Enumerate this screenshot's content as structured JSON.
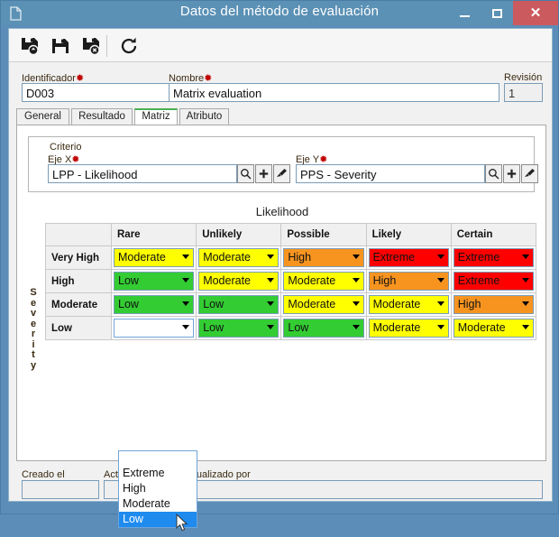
{
  "window": {
    "title": "Datos del método de evaluación",
    "icon": "document-icon",
    "controls": {
      "minimize": "–",
      "maximize": "□",
      "close": "✕"
    },
    "frame_color": "#5b8db8",
    "close_color": "#cb5a5e"
  },
  "toolbar": {
    "buttons": [
      {
        "name": "save-new-icon",
        "title": ""
      },
      {
        "name": "save-icon",
        "title": ""
      },
      {
        "name": "save-delete-icon",
        "title": ""
      },
      {
        "name": "refresh-icon",
        "title": ""
      }
    ]
  },
  "header_fields": {
    "identificador": {
      "label": "Identificador",
      "required": "✹",
      "value": "D003"
    },
    "nombre": {
      "label": "Nombre",
      "required": "✹",
      "value": "Matrix evaluation"
    },
    "revision": {
      "label": "Revisión",
      "value": "1"
    }
  },
  "tabs": [
    {
      "label": "General",
      "active": false
    },
    {
      "label": "Resultado",
      "active": false
    },
    {
      "label": "Matriz",
      "active": true
    },
    {
      "label": "Atributo",
      "active": false
    }
  ],
  "criterio": {
    "title": "Criterio",
    "eje_x": {
      "label": "Eje X",
      "required": "✹",
      "value": "LPP - Likelihood"
    },
    "eje_y": {
      "label": "Eje Y",
      "required": "✹",
      "value": "PPS - Severity"
    },
    "buttons": [
      "search-icon",
      "add-icon",
      "clear-brush-icon"
    ]
  },
  "matrix": {
    "x_axis_title": "Likelihood",
    "y_axis_title": "Severity",
    "columns": [
      "Rare",
      "Unlikely",
      "Possible",
      "Likely",
      "Certain"
    ],
    "rows": [
      {
        "header": "Very High",
        "cells": [
          {
            "value": "Moderate",
            "color": "#ffff00"
          },
          {
            "value": "Moderate",
            "color": "#ffff00"
          },
          {
            "value": "High",
            "color": "#f79420"
          },
          {
            "value": "Extreme",
            "color": "#ff0000"
          },
          {
            "value": "Extreme",
            "color": "#ff0000"
          }
        ]
      },
      {
        "header": "High",
        "cells": [
          {
            "value": "Low",
            "color": "#33cc33"
          },
          {
            "value": "Moderate",
            "color": "#ffff00"
          },
          {
            "value": "Moderate",
            "color": "#ffff00"
          },
          {
            "value": "High",
            "color": "#f79420"
          },
          {
            "value": "Extreme",
            "color": "#ff0000"
          }
        ]
      },
      {
        "header": "Moderate",
        "cells": [
          {
            "value": "Low",
            "color": "#33cc33"
          },
          {
            "value": "Low",
            "color": "#33cc33"
          },
          {
            "value": "Moderate",
            "color": "#ffff00"
          },
          {
            "value": "Moderate",
            "color": "#ffff00"
          },
          {
            "value": "High",
            "color": "#f79420"
          }
        ]
      },
      {
        "header": "Low",
        "cells": [
          {
            "value": "",
            "color": "#ffffff",
            "open": true
          },
          {
            "value": "Low",
            "color": "#33cc33"
          },
          {
            "value": "Low",
            "color": "#33cc33"
          },
          {
            "value": "Moderate",
            "color": "#ffff00"
          },
          {
            "value": "Moderate",
            "color": "#ffff00"
          }
        ]
      }
    ]
  },
  "dropdown": {
    "open": true,
    "options": [
      "",
      "Extreme",
      "High",
      "Moderate",
      "Low"
    ],
    "selected": "Low",
    "highlight_color": "#1f8bef"
  },
  "footer": {
    "creado_el": {
      "label": "Creado el",
      "value": ""
    },
    "actualizado_el": {
      "label": "Actualizado el",
      "value": ""
    },
    "actualizado_por": {
      "label": "Actualizado por",
      "value": ""
    }
  }
}
